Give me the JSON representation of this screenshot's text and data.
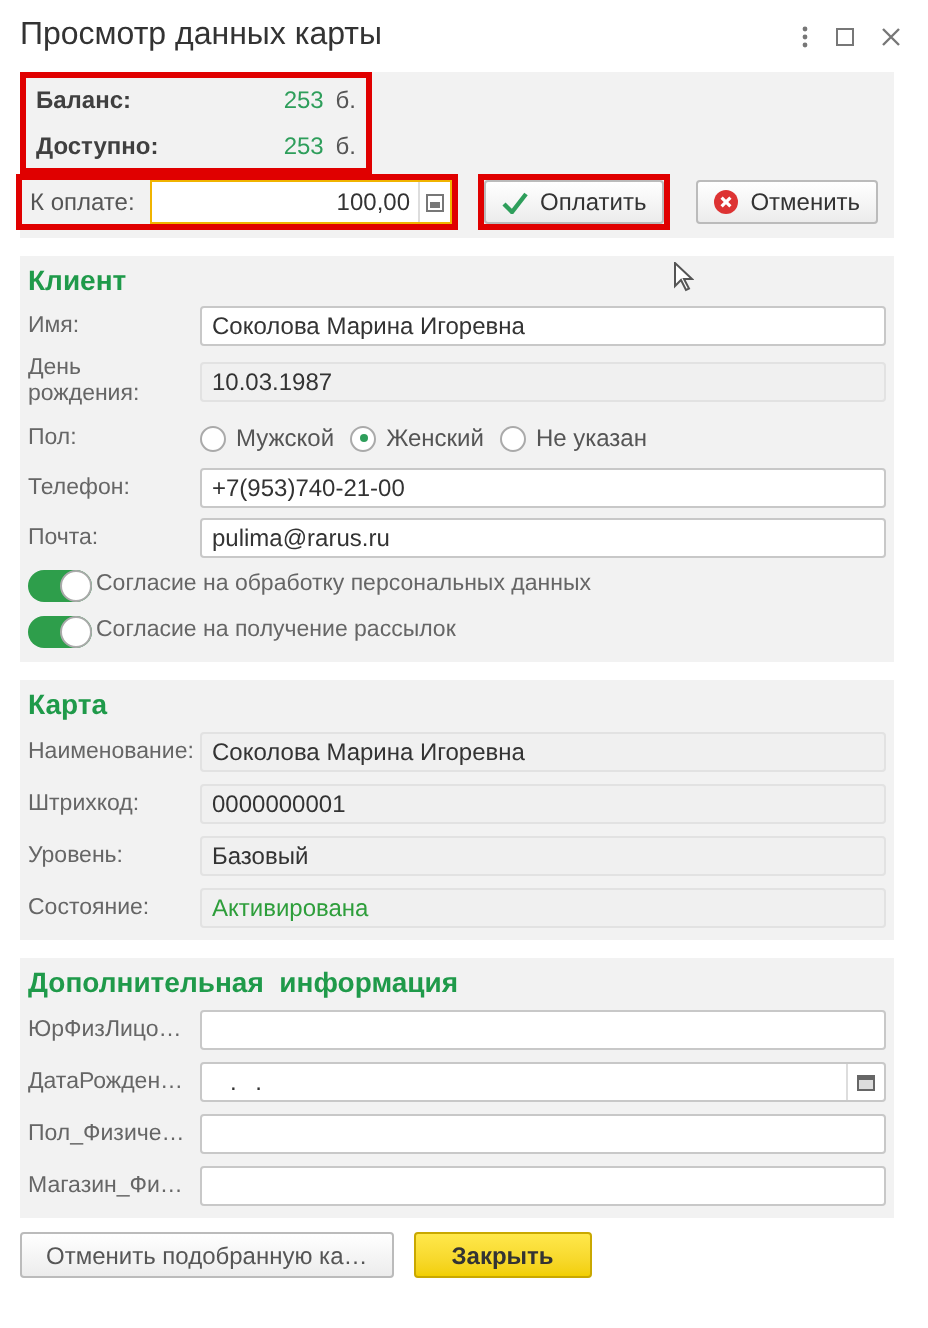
{
  "window": {
    "title": "Просмотр данных карты"
  },
  "summary": {
    "highlighted": true,
    "rows": [
      {
        "label": "Баланс:",
        "value": "253",
        "unit": "б."
      },
      {
        "label": "Доступно:",
        "value": "253",
        "unit": "б."
      }
    ],
    "payment": {
      "label": "К оплате:",
      "value": "100,00",
      "highlighted": true
    },
    "buttons": [
      {
        "kind": "confirm",
        "label": "Оплатить",
        "highlighted": true
      },
      {
        "kind": "cancel",
        "label": "Отменить",
        "highlighted": false
      }
    ]
  },
  "client": {
    "title": "Клиент",
    "fields": [
      {
        "kind": "text",
        "label": "Имя:",
        "value": "Соколова Марина Игоревна",
        "readonly": false
      },
      {
        "kind": "text",
        "label": "День рождения:",
        "value": "10.03.1987",
        "readonly": true
      },
      {
        "kind": "radio",
        "label": "Пол:",
        "options": [
          {
            "label": "Мужской",
            "selected": false
          },
          {
            "label": "Женский",
            "selected": true
          },
          {
            "label": "Не указан",
            "selected": false
          }
        ]
      },
      {
        "kind": "text",
        "label": "Телефон:",
        "value": "+7(953)740-21-00",
        "readonly": false
      },
      {
        "kind": "text",
        "label": "Почта:",
        "value": "pulima@rarus.ru",
        "readonly": false
      }
    ],
    "toggles": [
      {
        "label": "Согласие на обработку персональных данных",
        "on": true
      },
      {
        "label": "Согласие на получение рассылок",
        "on": true
      }
    ]
  },
  "card": {
    "title": "Карта",
    "fields": [
      {
        "kind": "text",
        "label": "Наименование:",
        "value": "Соколова Марина Игоревна",
        "readonly": true
      },
      {
        "kind": "text",
        "label": "Штрихкод:",
        "value": "0000000001",
        "readonly": true
      },
      {
        "kind": "text",
        "label": "Уровень:",
        "value": "Базовый",
        "readonly": true
      },
      {
        "kind": "status",
        "label": "Состояние:",
        "value": "Активирована",
        "readonly": true
      }
    ]
  },
  "extra": {
    "title": "Дополнительная  информация",
    "fields": [
      {
        "kind": "text",
        "label": "ЮрФизЛицо…",
        "readonly": false
      },
      {
        "kind": "date",
        "label": "ДатаРожден…",
        "value": ". .",
        "readonly": false
      },
      {
        "kind": "text",
        "label": "Пол_Физиче…",
        "readonly": false
      },
      {
        "kind": "text",
        "label": "Магазин_Фи…",
        "readonly": false
      }
    ]
  },
  "buttons": [
    {
      "kind": "default",
      "label": "Отменить подобранную ка…"
    },
    {
      "kind": "primary",
      "label": "Закрыть"
    }
  ]
}
